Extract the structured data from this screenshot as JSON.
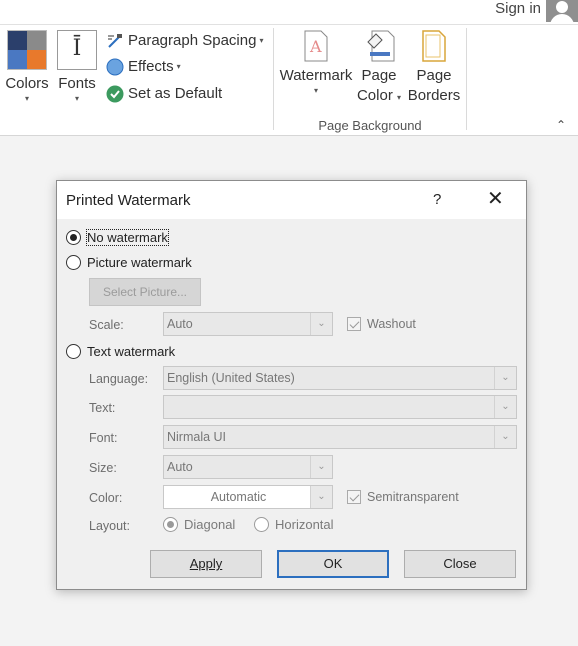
{
  "account": {
    "signin_label": "Sign in"
  },
  "ribbon": {
    "colors_label": "Colors",
    "fonts_label": "Fonts",
    "fonts_glyph": "Ī",
    "paragraph_spacing_label": "Paragraph Spacing",
    "effects_label": "Effects",
    "set_default_label": "Set as Default",
    "watermark_label": "Watermark",
    "page_color_label_1": "Page",
    "page_color_label_2": "Color",
    "page_borders_label_1": "Page",
    "page_borders_label_2": "Borders",
    "group_label": "Page Background",
    "dropdown_glyph": "▾",
    "collapse_glyph": "⌃"
  },
  "dialog": {
    "title": "Printed Watermark",
    "help_glyph": "?",
    "close_glyph": "✕",
    "no_watermark": "No watermark",
    "picture_watermark": "Picture watermark",
    "select_picture": "Select Picture...",
    "scale_label": "Scale:",
    "scale_value": "Auto",
    "washout_label": "Washout",
    "text_watermark": "Text watermark",
    "language_label": "Language:",
    "language_value": "English (United States)",
    "text_label": "Text:",
    "text_value": "",
    "font_label": "Font:",
    "font_value": "Nirmala UI",
    "size_label": "Size:",
    "size_value": "Auto",
    "color_label": "Color:",
    "color_value": "Automatic",
    "semitransparent_label": "Semitransparent",
    "layout_label": "Layout:",
    "diagonal_label": "Diagonal",
    "horizontal_label": "Horizontal",
    "apply_label": "Apply",
    "ok_label": "OK",
    "close_label": "Close",
    "arrow_glyph": "⌄"
  },
  "colors": {
    "accent_blue": "#2c6fbf",
    "swatch_navy": "#2b3f6b",
    "swatch_gray": "#8a8a8a",
    "swatch_blue": "#4a78c2",
    "swatch_orange": "#e8792c"
  }
}
